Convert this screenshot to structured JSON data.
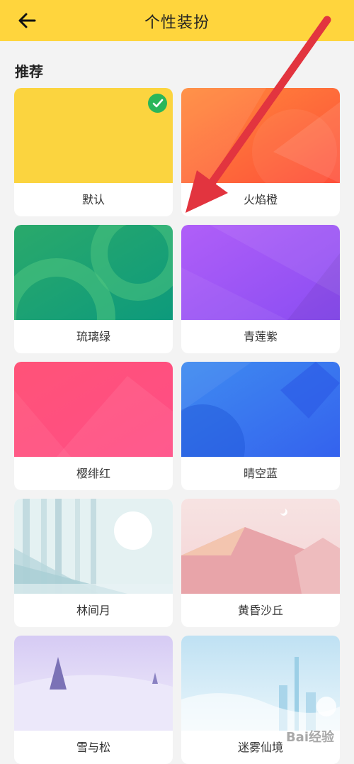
{
  "header": {
    "title": "个性装扮",
    "back_icon": "arrow-left-icon"
  },
  "section": {
    "title": "推荐"
  },
  "themes": [
    {
      "label": "默认",
      "selected": true,
      "color": "#fbd43f"
    },
    {
      "label": "火焰橙",
      "selected": false,
      "color": "#fe6b3a"
    },
    {
      "label": "琉璃绿",
      "selected": false,
      "color": "#2dae74"
    },
    {
      "label": "青莲紫",
      "selected": false,
      "color": "#a75bf7"
    },
    {
      "label": "樱绯红",
      "selected": false,
      "color": "#ff5081"
    },
    {
      "label": "晴空蓝",
      "selected": false,
      "color": "#3a79f0"
    },
    {
      "label": "林间月",
      "selected": false,
      "color": "#cfe4e6"
    },
    {
      "label": "黄昏沙丘",
      "selected": false,
      "color": "#f2c9cb"
    },
    {
      "label": "雪与松",
      "selected": false,
      "color": "#dcd3f3"
    },
    {
      "label": "迷雾仙境",
      "selected": false,
      "color": "#cfe8f5"
    }
  ],
  "annotation": {
    "color": "#e2343f"
  },
  "watermark": {
    "text": "Bai经验"
  }
}
